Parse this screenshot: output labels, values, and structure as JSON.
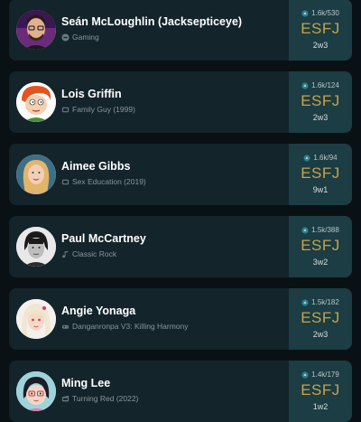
{
  "profiles": [
    {
      "name": "Seán McLoughlin (Jacksepticeye)",
      "category": "Gaming",
      "category_icon": "gamepad-icon",
      "votes": "1.6k/530",
      "type": "ESFJ",
      "wing": "2w3"
    },
    {
      "name": "Lois Griffin",
      "category": "Family Guy (1999)",
      "category_icon": "tv-icon",
      "votes": "1.6k/124",
      "type": "ESFJ",
      "wing": "2w3"
    },
    {
      "name": "Aimee Gibbs",
      "category": "Sex Education (2019)",
      "category_icon": "tv-icon",
      "votes": "1.6k/94",
      "type": "ESFJ",
      "wing": "9w1"
    },
    {
      "name": "Paul McCartney",
      "category": "Classic Rock",
      "category_icon": "music-note-icon",
      "votes": "1.5k/388",
      "type": "ESFJ",
      "wing": "3w2"
    },
    {
      "name": "Angie Yonaga",
      "category": "Danganronpa V3: Killing Harmony",
      "category_icon": "gamepad-icon",
      "votes": "1.5k/182",
      "type": "ESFJ",
      "wing": "2w3"
    },
    {
      "name": "Ming Lee",
      "category": "Turning Red (2022)",
      "category_icon": "film-icon",
      "votes": "1.4k/179",
      "type": "ESFJ",
      "wing": "1w2"
    }
  ],
  "colors": {
    "background": "#0a1115",
    "card": "#13242b",
    "panel": "#1b3d43",
    "type_text": "#c9a24a",
    "name_text": "#ffffff",
    "sub_text": "#8b979c"
  }
}
